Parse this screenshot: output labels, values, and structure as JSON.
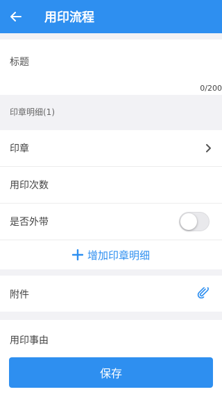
{
  "header": {
    "title": "用印流程",
    "back_icon": "arrow-left-icon"
  },
  "title_field": {
    "label": "标题",
    "counter": "0/200"
  },
  "seal_section": {
    "heading": "印章明细(1)",
    "seal_row": {
      "label": "印章",
      "icon": "chevron-right-icon"
    },
    "count_row": {
      "label": "用印次数"
    },
    "carry_out_row": {
      "label": "是否外带",
      "toggle_on": false
    },
    "add_button": {
      "label": "增加印章明细",
      "icon": "plus-icon"
    }
  },
  "attachment": {
    "label": "附件",
    "icon": "paperclip-icon"
  },
  "reason": {
    "label": "用印事由"
  },
  "save_button": {
    "label": "保存"
  },
  "colors": {
    "accent": "#2e8ff0",
    "background": "#f2f2f5"
  }
}
